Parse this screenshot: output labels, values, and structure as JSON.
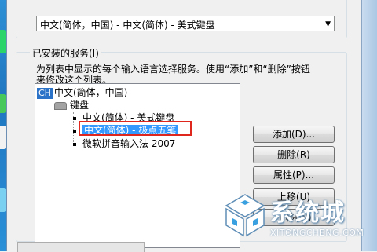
{
  "language_combo": {
    "value": "中文(简体，中国) - 中文(简体) - 美式键盘",
    "arrow_icon": "dropdown-arrow-icon"
  },
  "services": {
    "group_label": "已安装的服务(I)",
    "description_line1": "为列表中显示的每个输入语言选择服务。使用“添加”和“删除”按钮",
    "description_line2": "来修改这个列表。",
    "tree": {
      "language": {
        "badge": "CH",
        "label": "中文(简体，中国)"
      },
      "category": {
        "icon": "keyboard-icon",
        "label": "键盘"
      },
      "items": [
        {
          "label": "中文(简体) - 美式键盘",
          "selected": false
        },
        {
          "label": "中文(简体) - 极点五笔",
          "selected": true
        },
        {
          "label": "微软拼音输入法 2007",
          "selected": false
        }
      ]
    }
  },
  "buttons": {
    "add": "添加(D)...",
    "remove": "删除(R)",
    "properties": "属性(P)...",
    "move_up": "上移(U)",
    "move_down": "下移(W)"
  },
  "watermark": {
    "text": "系统城",
    "url": "XITONGCHENG.COM"
  },
  "colors": {
    "selection": "#3399ff",
    "highlight_border": "#e0271d",
    "ch_badge": "#2a73c9"
  }
}
